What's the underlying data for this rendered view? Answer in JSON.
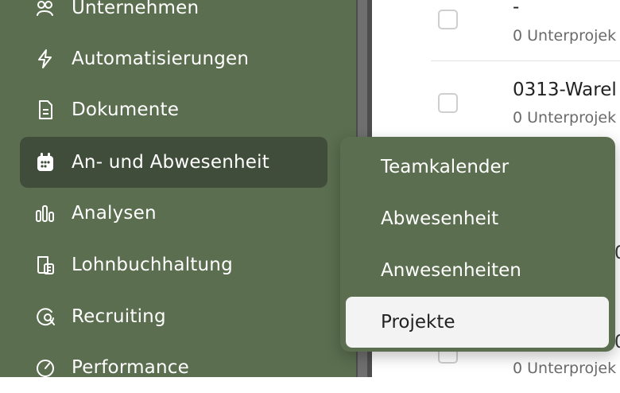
{
  "sidebar": {
    "items": [
      {
        "label": "Unternehmen",
        "icon": "company-icon"
      },
      {
        "label": "Automatisierungen",
        "icon": "lightning-icon"
      },
      {
        "label": "Dokumente",
        "icon": "document-icon"
      },
      {
        "label": "An- und Abwesenheit",
        "icon": "calendar-icon",
        "active": true
      },
      {
        "label": "Analysen",
        "icon": "bar-chart-icon"
      },
      {
        "label": "Lohnbuchhaltung",
        "icon": "payroll-icon"
      },
      {
        "label": "Recruiting",
        "icon": "recruiting-icon"
      },
      {
        "label": "Performance",
        "icon": "gauge-icon"
      }
    ]
  },
  "submenu": {
    "items": [
      {
        "label": "Teamkalender"
      },
      {
        "label": "Abwesenheit"
      },
      {
        "label": "Anwesenheiten"
      },
      {
        "label": "Projekte",
        "highlighted": true
      }
    ]
  },
  "table": {
    "rows": [
      {
        "title": "-",
        "subtitle": "0 Unterprojek"
      },
      {
        "title": "0313-Warel",
        "subtitle": "0 Unterprojek"
      }
    ],
    "last_subtitle": "0 Unterprojek",
    "peek_chars": [
      "0",
      "0"
    ]
  },
  "colors": {
    "sidebar_bg": "#5b6e4f",
    "active_bg": "#3f4d3a",
    "highlight_bg": "#f3f3f3"
  }
}
